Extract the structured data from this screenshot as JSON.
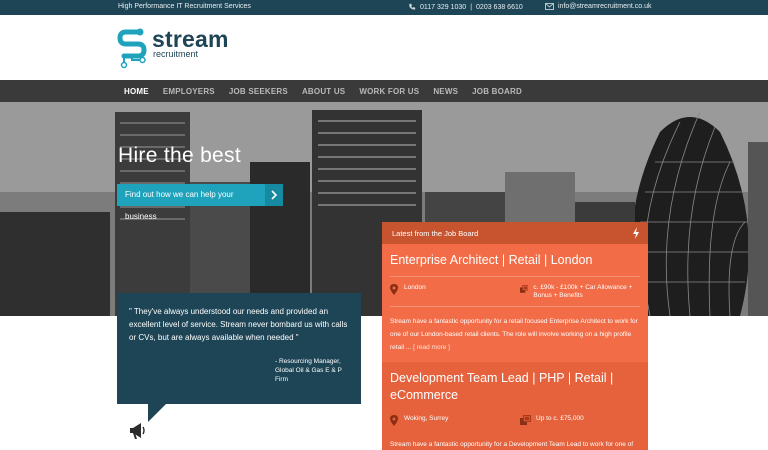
{
  "topbar": {
    "tagline": "High Performance IT Recruitment Services",
    "phone1": "0117 329 1030",
    "phone_sep": "|",
    "phone2": "0203 638 6610",
    "email": "info@streamrecruitment.co.uk"
  },
  "logo": {
    "word": "stream",
    "sub": "recruitment"
  },
  "nav": {
    "items": [
      "HOME",
      "EMPLOYERS",
      "JOB SEEKERS",
      "ABOUT US",
      "WORK FOR US",
      "NEWS",
      "JOB BOARD"
    ]
  },
  "hero": {
    "title": "Hire the best",
    "cta_label": "Find out how we can help your business"
  },
  "testimonial": {
    "quote": "\" They've always understood our needs and provided an excellent level of service. Stream never bombard us with calls or CVs, but are always available when needed \"",
    "attribution": "- Resourcing Manager, Global Oil & Gas E & P Firm"
  },
  "jobboard": {
    "heading": "Latest from the Job Board",
    "jobs": [
      {
        "title": "Enterprise Architect | Retail | London",
        "location": "London",
        "salary": "c. £90k - £100k + Car Allowance + Bonus + Benefits",
        "description": "Stream have a fantastic opportunity for a retail focused Enterprise Architect to work for one of our London-based retail clients. The role will involve working on a high profile retail ...",
        "read_more": "[ read more ]"
      },
      {
        "title": "Development Team Lead | PHP | Retail | eCommerce",
        "location": "Woking, Surrey",
        "salary": "Up to c. £75,000",
        "description": "Stream have a fantastic opportunity for a Development Team Lead to work for one of our clients based near Woking. The successful candidate will be"
      }
    ]
  },
  "colors": {
    "navy": "#1e4556",
    "teal": "#1fa3bc",
    "orange": "#f26c47",
    "nav_bg": "#3a3a3a"
  },
  "icons": [
    "phone-icon",
    "email-icon",
    "arrow-right-icon",
    "lightning-icon",
    "map-pin-icon",
    "money-icon",
    "megaphone-icon"
  ]
}
